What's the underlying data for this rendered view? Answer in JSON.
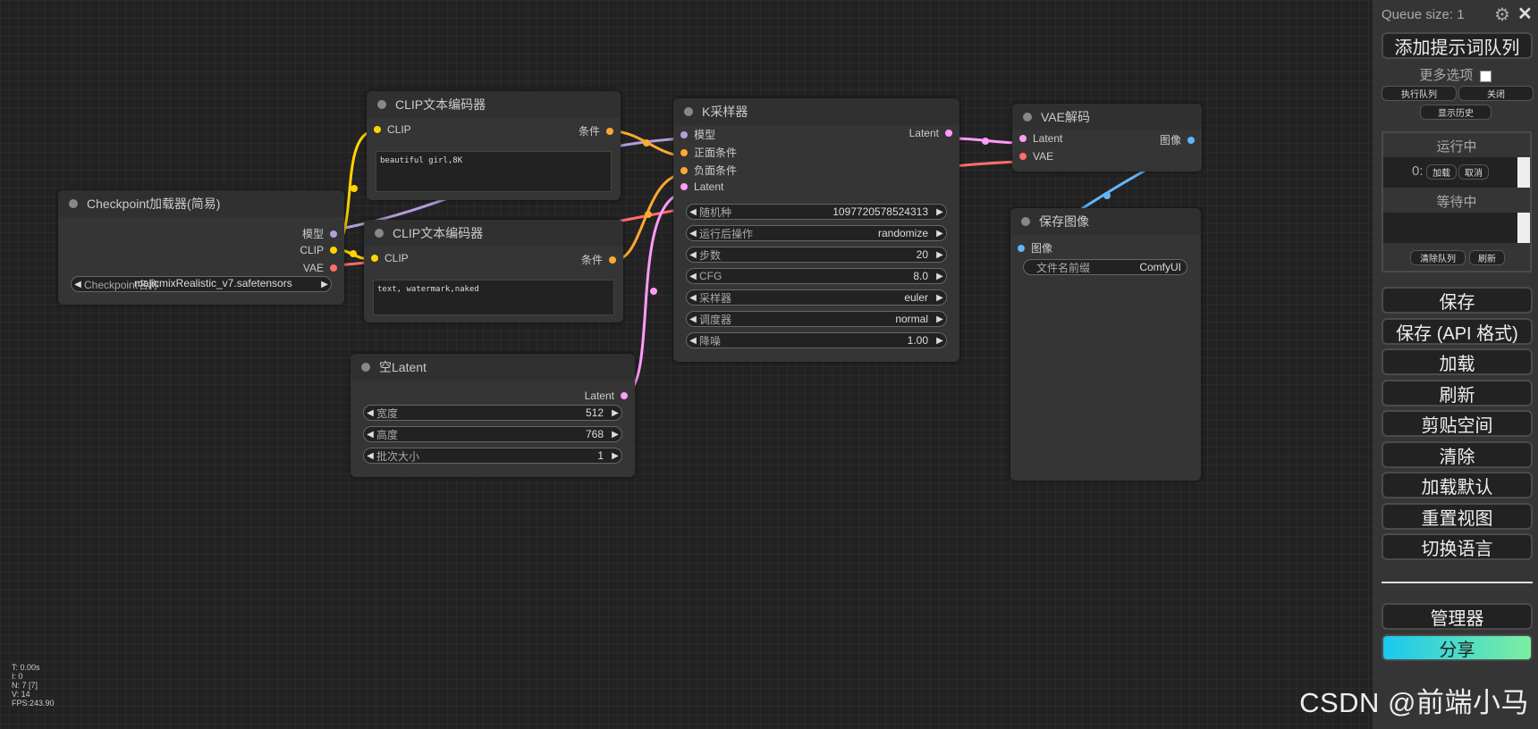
{
  "canvas": {
    "nodes": {
      "checkpoint": {
        "title": "Checkpoint加载器(简易)",
        "outputs": [
          "模型",
          "CLIP",
          "VAE"
        ],
        "widget": {
          "label": "Checkpoint名称",
          "value": "majicmixRealistic_v7.safetensors"
        }
      },
      "clip_pos": {
        "title": "CLIP文本编码器",
        "input": "CLIP",
        "output": "条件",
        "text": "beautiful girl,8K"
      },
      "clip_neg": {
        "title": "CLIP文本编码器",
        "input": "CLIP",
        "output": "条件",
        "text": "text, watermark,naked"
      },
      "empty_latent": {
        "title": "空Latent",
        "output": "Latent",
        "widgets": [
          {
            "label": "宽度",
            "value": "512"
          },
          {
            "label": "高度",
            "value": "768"
          },
          {
            "label": "批次大小",
            "value": "1"
          }
        ]
      },
      "ksampler": {
        "title": "K采样器",
        "inputs": [
          "模型",
          "正面条件",
          "负面条件",
          "Latent"
        ],
        "output": "Latent",
        "widgets": [
          {
            "label": "随机种",
            "value": "1097720578524313"
          },
          {
            "label": "运行后操作",
            "value": "randomize"
          },
          {
            "label": "步数",
            "value": "20"
          },
          {
            "label": "CFG",
            "value": "8.0"
          },
          {
            "label": "采样器",
            "value": "euler"
          },
          {
            "label": "调度器",
            "value": "normal"
          },
          {
            "label": "降噪",
            "value": "1.00"
          }
        ]
      },
      "vae_decode": {
        "title": "VAE解码",
        "inputs": [
          "Latent",
          "VAE"
        ],
        "output": "图像"
      },
      "save_image": {
        "title": "保存图像",
        "input": "图像",
        "widget": {
          "label": "文件名前缀",
          "value": "ComfyUI"
        }
      }
    },
    "stats": [
      "T: 0.00s",
      "I: 0",
      "N: 7 [7]",
      "V: 14",
      "FPS:243.90"
    ],
    "watermark": "CSDN @前端小马"
  },
  "panel": {
    "queue_size": "Queue size: 1",
    "add_queue": "添加提示词队列",
    "more_options": "更多选项",
    "exec_queue": "执行队列",
    "close": "关闭",
    "show_history": "显示历史",
    "running": "运行中",
    "running_item": "0:",
    "load": "加载",
    "cancel": "取消",
    "pending": "等待中",
    "clear_queue": "清除队列",
    "refresh_small": "刷新",
    "buttons": [
      "保存",
      "保存 (API 格式)",
      "加载",
      "刷新",
      "剪贴空间",
      "清除",
      "加载默认",
      "重置视图",
      "切换语言"
    ],
    "manager": "管理器",
    "share": "分享"
  },
  "colors": {
    "model": "#b39ddb",
    "clip": "#ffd500",
    "vae": "#ff6e6e",
    "conditioning": "#ffa931",
    "latent": "#ff9cf9",
    "image": "#64b5f6",
    "share_gradient_start": "#1ac8f0",
    "share_gradient_end": "#7deea0"
  }
}
